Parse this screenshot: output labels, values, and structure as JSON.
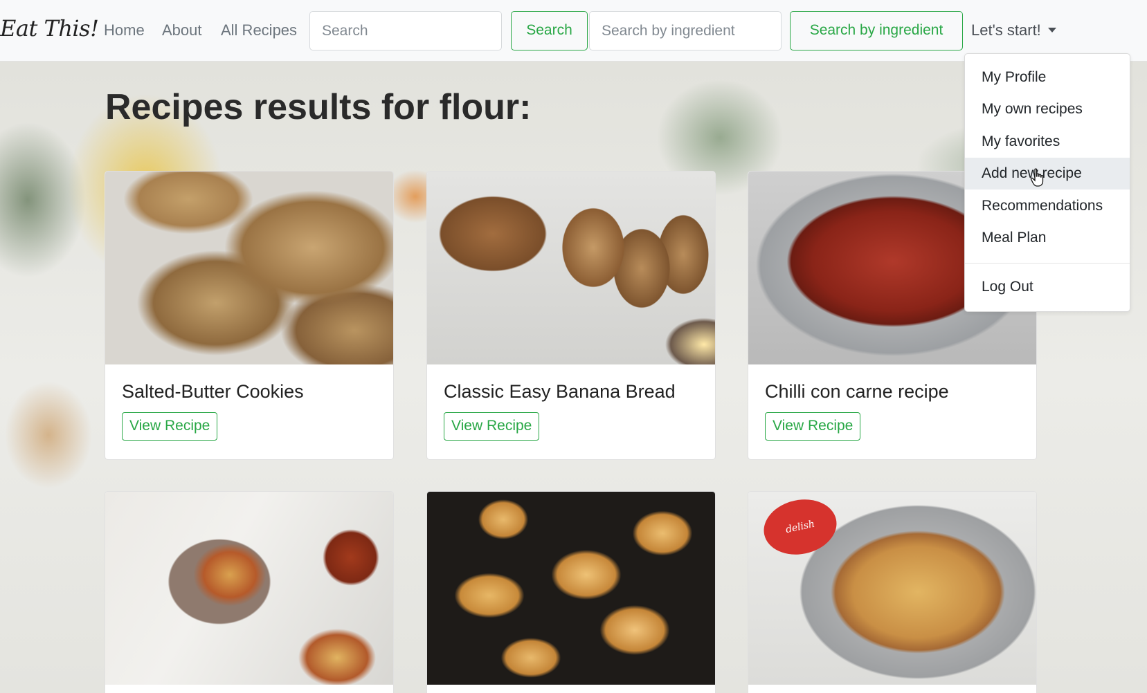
{
  "navbar": {
    "brand": "Eat This!",
    "links": [
      "Home",
      "About",
      "All Recipes"
    ],
    "search_placeholder": "Search",
    "search_button": "Search",
    "ingredient_placeholder": "Search by ingredient",
    "ingredient_button": "Search by ingredient",
    "dropdown_label": "Let's start!"
  },
  "main": {
    "title": "Recipes results for flour:",
    "recipes": [
      {
        "title": "Salted-Butter Cookies",
        "button": "View Recipe"
      },
      {
        "title": "Classic Easy Banana Bread",
        "button": "View Recipe"
      },
      {
        "title": "Chilli con carne recipe",
        "button": "View Recipe"
      },
      {
        "title": "",
        "button": ""
      },
      {
        "title": "",
        "button": ""
      },
      {
        "title": "",
        "button": ""
      }
    ],
    "badge_text": "delish"
  },
  "dropdown": {
    "items": [
      "My Profile",
      "My own recipes",
      "My favorites",
      "Add new recipe",
      "Recommendations",
      "Meal Plan"
    ],
    "logout": "Log Out",
    "hovered_item": "Add new recipe"
  },
  "colors": {
    "accent": "#28a745",
    "navbar_bg": "#f8f9fa",
    "text_muted": "#6c757d"
  }
}
